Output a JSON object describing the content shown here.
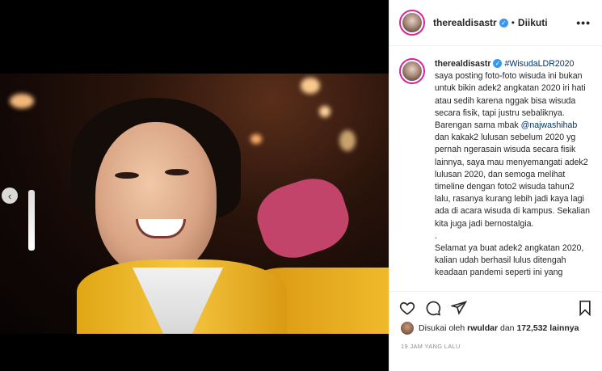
{
  "post": {
    "username": "therealdisastr",
    "follow_status": "Diikuti",
    "separator": "•",
    "more_label": "•••"
  },
  "caption": {
    "username": "therealdisastr",
    "hashtag": "#WisudaLDR2020",
    "line1": "saya posting foto-foto wisuda ini bukan untuk bikin adek2 angkatan 2020 iri hati atau sedih karena nggak bisa wisuda secara fisik, tapi justru sebaliknya. Barengan sama mbak ",
    "mention": "@najwashihab",
    "line2": " dan kakak2 lulusan sebelum 2020 yg pernah ngerasain wisuda secara fisik lainnya, saya mau menyemangati adek2 lulusan 2020, dan semoga melihat timeline dengan foto2 wisuda tahun2 lalu, rasanya kurang lebih jadi kaya lagi ada di acara wisuda di kampus. Sekalian kita juga jadi bernostalgia.",
    "line3": ".",
    "line4": "Selamat ya buat adek2 angkatan 2020, kalian udah berhasil lulus ditengah keadaan pandemi seperti ini yang"
  },
  "likes": {
    "prefix": "Disukai oleh",
    "liker": "rwuldar",
    "connector": "dan",
    "count": "172,532 lainnya"
  },
  "timestamp": "19 JAM YANG LALU",
  "icons": {
    "prev": "chevron-left-icon",
    "like": "heart-icon",
    "comment": "comment-icon",
    "share": "share-icon",
    "save": "bookmark-icon"
  },
  "colors": {
    "link": "#003569",
    "verified": "#3897f0",
    "story_ring": "#d6249f"
  }
}
